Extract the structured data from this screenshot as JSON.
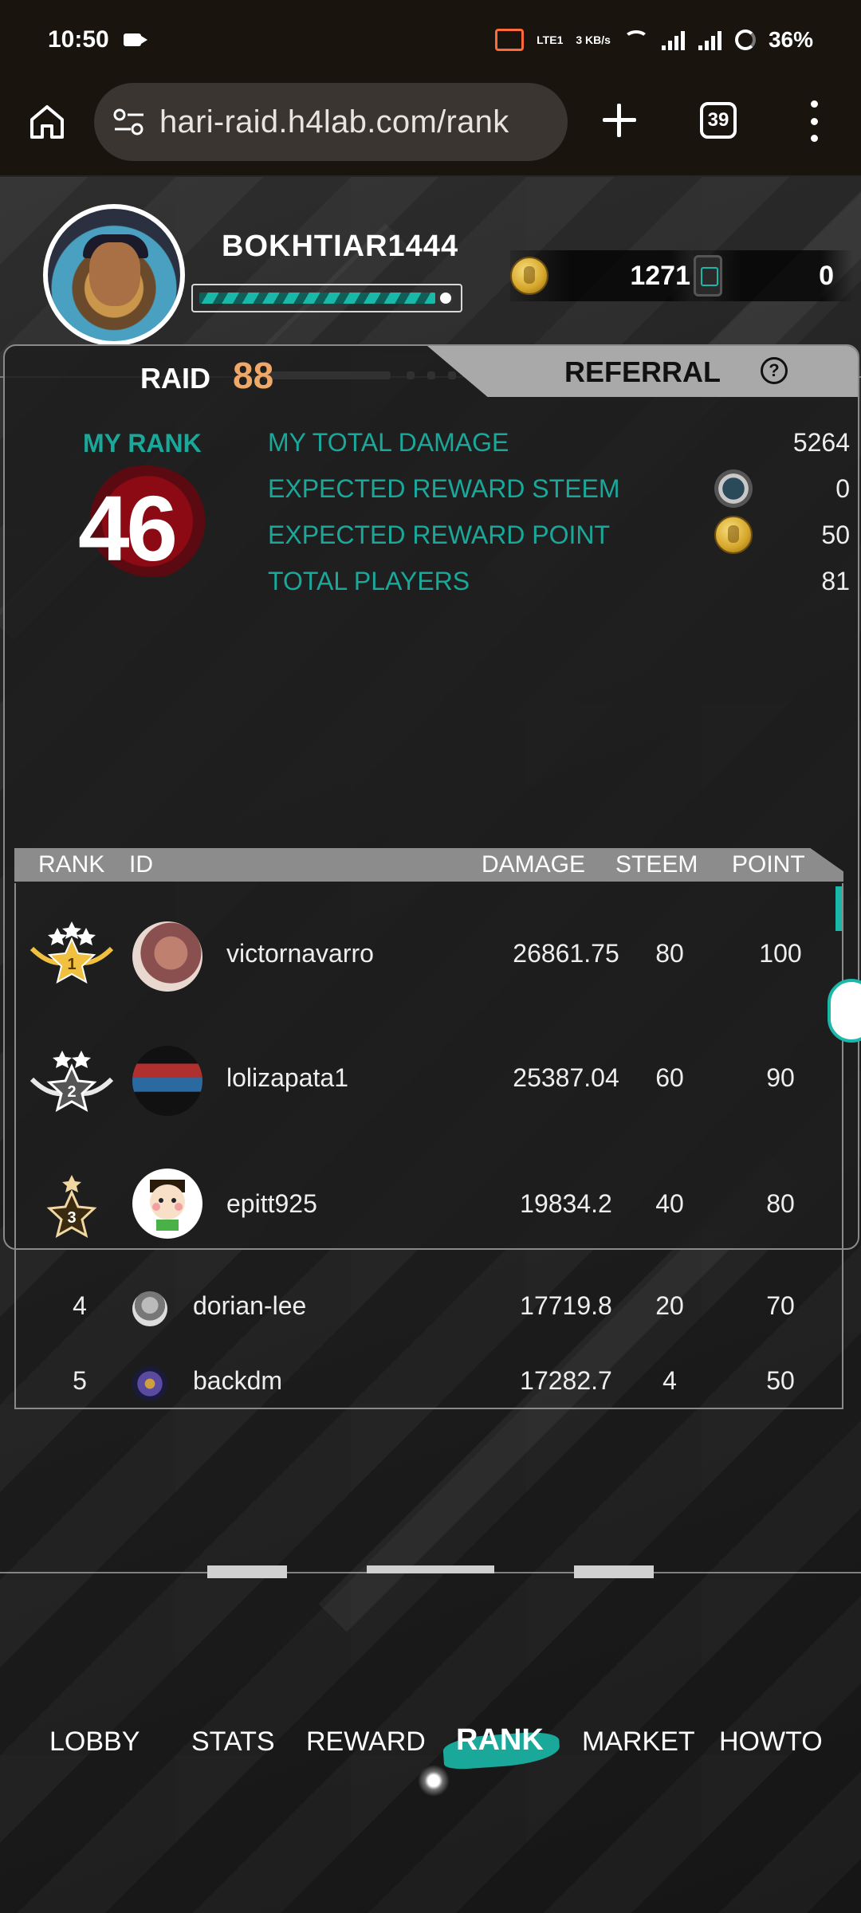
{
  "status_bar": {
    "time": "10:50",
    "network_text": "LTE1",
    "speed_text": "3 KB/s",
    "battery": "36%"
  },
  "browser": {
    "url": "hari-raid.h4lab.com/rank",
    "tab_count": "39"
  },
  "profile": {
    "username": "BOKHTIAR1444",
    "xp_progress": 0.88,
    "coins": "1271",
    "tickets": "0"
  },
  "tabs": {
    "raid_label": "RAID",
    "raid_number": "88",
    "referral_label": "REFERRAL",
    "help": "?"
  },
  "my_rank": {
    "label": "MY RANK",
    "rank": "46",
    "stats": [
      {
        "label": "MY TOTAL DAMAGE",
        "value": "5264"
      },
      {
        "label": "EXPECTED REWARD STEEM",
        "value": "0",
        "icon": "steem-icon"
      },
      {
        "label": "EXPECTED REWARD POINT",
        "value": "50",
        "icon": "coin-icon"
      },
      {
        "label": "TOTAL PLAYERS",
        "value": "81"
      }
    ]
  },
  "table": {
    "headers": {
      "rank": "RANK",
      "id": "ID",
      "damage": "DAMAGE",
      "steem": "STEEM",
      "point": "POINT"
    },
    "rows": [
      {
        "rank": "1",
        "id": "victornavarro",
        "damage": "26861.75",
        "steem": "80",
        "point": "100"
      },
      {
        "rank": "2",
        "id": "lolizapata1",
        "damage": "25387.04",
        "steem": "60",
        "point": "90"
      },
      {
        "rank": "3",
        "id": "epitt925",
        "damage": "19834.2",
        "steem": "40",
        "point": "80"
      },
      {
        "rank": "4",
        "id": "dorian-lee",
        "damage": "17719.8",
        "steem": "20",
        "point": "70"
      },
      {
        "rank": "5",
        "id": "backdm",
        "damage": "17282.7",
        "steem": "4",
        "point": "50"
      }
    ]
  },
  "nav": {
    "items": [
      "LOBBY",
      "STATS",
      "REWARD",
      "RANK",
      "MARKET",
      "HOWTO"
    ],
    "active": "RANK"
  },
  "colors": {
    "accent": "#19a89a",
    "raid_number": "#f0a868",
    "panel_border": "#8a8a8a"
  }
}
